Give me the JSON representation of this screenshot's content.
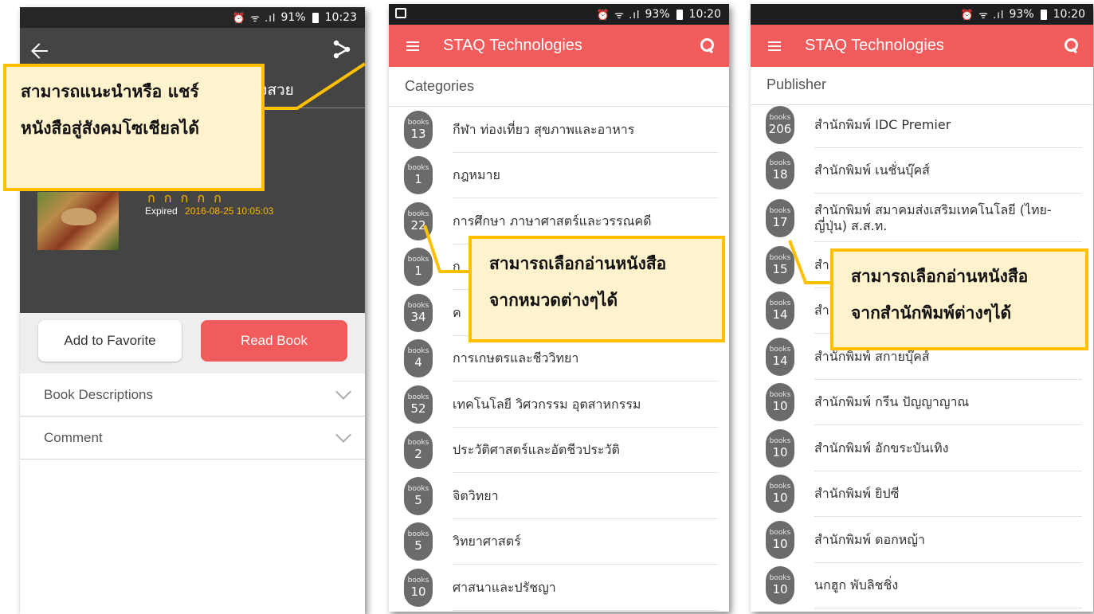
{
  "screen_detail": {
    "status": {
      "icons": "⏰ ᯤ .ıl",
      "battery": "91%",
      "time": "10:23"
    },
    "book_title_fragment": "ยงสวย",
    "author_fragment": "ก ก ก ก ก",
    "expired_label": "Expired",
    "expired_date": "2016-08-25 10:05:03",
    "buttons": {
      "favorite": "Add to Favorite",
      "read": "Read Book"
    },
    "accordion": [
      {
        "label": "Book Descriptions"
      },
      {
        "label": "Comment"
      }
    ]
  },
  "screen_categories": {
    "status": {
      "icons": "⏰ ᯤ .ıl",
      "battery": "93%",
      "time": "10:20"
    },
    "app_title": "STAQ Technologies",
    "section_title": "Categories",
    "badge_caption": "books",
    "items": [
      {
        "count": "13",
        "label": "กีฬา ท่องเที่ยว สุขภาพและอาหาร"
      },
      {
        "count": "1",
        "label": "กฎหมาย"
      },
      {
        "count": "22",
        "label": "การศึกษา ภาษาศาสตร์และวรรณคดี"
      },
      {
        "count": "1",
        "label": "ก"
      },
      {
        "count": "34",
        "label": "ค"
      },
      {
        "count": "4",
        "label": "การเกษตรและชีววิทยา"
      },
      {
        "count": "52",
        "label": "เทคโนโลยี วิศวกรรม อุตสาหกรรม"
      },
      {
        "count": "2",
        "label": "ประวัติศาสตร์และอัตชีวประวัติ"
      },
      {
        "count": "5",
        "label": "จิตวิทยา"
      },
      {
        "count": "5",
        "label": "วิทยาศาสตร์"
      },
      {
        "count": "10",
        "label": "ศาสนาและปรัชญา"
      }
    ]
  },
  "screen_publishers": {
    "status": {
      "icons": "⏰ ᯤ .ıl",
      "battery": "93%",
      "time": "10:20"
    },
    "app_title": "STAQ Technologies",
    "section_title": "Publisher",
    "badge_caption": "books",
    "items": [
      {
        "count": "206",
        "label": "สำนักพิมพ์ IDC Premier"
      },
      {
        "count": "18",
        "label": "สำนักพิมพ์ เนชั่นบุ๊คส์"
      },
      {
        "count": "17",
        "label": "สำนักพิมพ์ สมาคมส่งเสริมเทคโนโลยี (ไทย-ญี่ปุ่น) ส.ส.ท."
      },
      {
        "count": "15",
        "label": "สำ"
      },
      {
        "count": "14",
        "label": "สำ"
      },
      {
        "count": "14",
        "label": "สำนักพิมพ์ สกายบุ๊คส์"
      },
      {
        "count": "10",
        "label": "สำนักพิมพ์ กรีน ปัญญาญาณ"
      },
      {
        "count": "10",
        "label": "สำนักพิมพ์ อักขระบันเทิง"
      },
      {
        "count": "10",
        "label": "สำนักพิมพ์ ยิปซี"
      },
      {
        "count": "10",
        "label": "สำนักพิมพ์ ดอกหญ้า"
      },
      {
        "count": "10",
        "label": "นกฮูก พับลิชชิ่ง"
      }
    ]
  },
  "callouts": {
    "share_line1": "สามารถแนะนำหรือ แชร์",
    "share_line2": "หนังสือสู่สังคมโซเชียลได้",
    "category_line1": "สามารถเลือกอ่านหนังสือ",
    "category_line2": "จากหมวดต่างๆได้",
    "publisher_line1": "สามารถเลือกอ่านหนังสือ",
    "publisher_line2": "จากสำนักพิมพ์ต่างๆได้"
  },
  "colors": {
    "accent": "#f15b5b",
    "callout_border": "#ffc000",
    "callout_fill": "#fff2cc",
    "badge": "#6b6b6b",
    "expired_date": "#ffb300"
  }
}
